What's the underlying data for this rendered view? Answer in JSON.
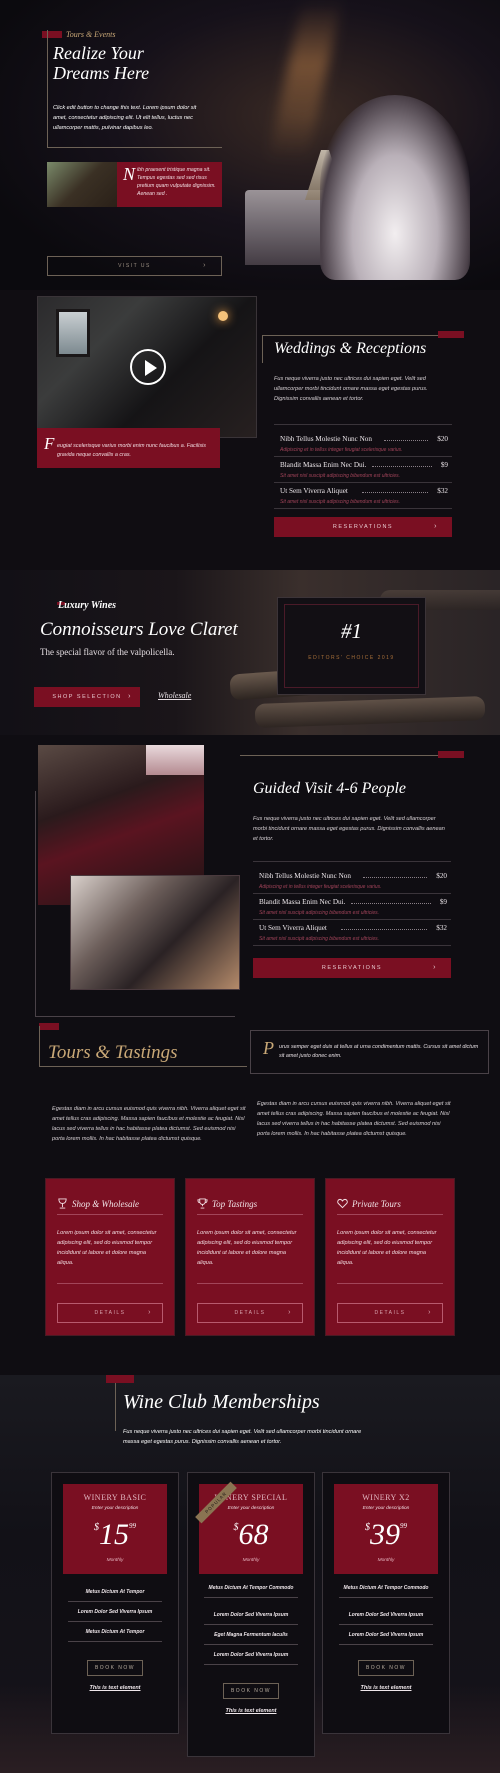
{
  "hero": {
    "tag": "Tours & Events",
    "title_line1": "Realize Your",
    "title_line2": "Dreams Here",
    "text": "Click edit button to change this text. Lorem ipsum dolor sit amet, consectetur adipiscing elit. Ut elit tellus, luctus nec ullamcorper mattis, pulvinar dapibus leo.",
    "box_dropcap": "N",
    "box_text": "ibh praesent tristique magna sit. Tempus egestas sed sed risus pretium quam vulputate dignissim. Aenean sed .",
    "visit_label": "VISIT US",
    "arrow": "›"
  },
  "weddings": {
    "title": "Weddings & Receptions",
    "text": "Fus neque viverra justo nec ultrices dui sapien eget. Velit sed ullamcorper morbi tincidunt ornare massa eget egestas purus. Dignissim convallis aenean et tortor.",
    "caption_dropcap": "F",
    "caption_text": "eugiat scelerisque varius morbi enim nunc faucibus a. Facilisis gravida neque convallis a cras.",
    "items": [
      {
        "name": "Nibh Tellus Molestie Nunc Non",
        "price": "$20",
        "desc": "Adipiscing et in tellus integer feugiat scelerisque varius."
      },
      {
        "name": "Blandit Massa Enim Nec Dui.",
        "price": "$9",
        "desc": "Sit amet nisl suscipit adipiscing bibendum est ultricies."
      },
      {
        "name": "Ut Sem Viverra Aliquet",
        "price": "$32",
        "desc": "Sit amet nisl suscipit adipiscing bibendum est ultricies."
      }
    ],
    "button": "RESERVATIONS",
    "arrow": "›"
  },
  "claret": {
    "script": "Luxury Wines",
    "title": "Connoisseurs Love Claret",
    "subtitle": "The special flavor of the valpolicella.",
    "shop_button": "SHOP SELECTION",
    "arrow": "›",
    "wholesale_link": "Wholesale",
    "badge_number": "#1",
    "badge_text": "EDITORS' CHOICE 2019"
  },
  "guided": {
    "title": "Guided Visit 4-6 People",
    "text": "Fus neque viverra justo nec ultrices dui sapien eget. Velit sed ullamcorper morbi tincidunt ornare massa eget egestas purus. Dignissim convallis aenean et tortor.",
    "items": [
      {
        "name": "Nibh Tellus Molestie Nunc Non",
        "price": "$20",
        "desc": "Adipiscing et in tellus integer feugiat scelerisque varius."
      },
      {
        "name": "Blandit Massa Enim Nec Dui.",
        "price": "$9",
        "desc": "Sit amet nisl suscipit adipiscing bibendum est ultricies."
      },
      {
        "name": "Ut Sem Viverra Aliquet",
        "price": "$32",
        "desc": "Sit amet nisl suscipit adipiscing bibendum est ultricies."
      }
    ],
    "button": "RESERVATIONS",
    "arrow": "›"
  },
  "tours": {
    "title": "Tours & Tastings",
    "side_dropcap": "P",
    "side_text": "urus semper eget duis at tellus at urna condimentum mattis. Cursus sit amet dictum sit amet justo donec enim.",
    "col1": "Egestas diam in arcu cursus euismod quis viverra nibh. Viverra aliquet eget sit amet tellus cras adipiscing. Massa sapien faucibus et molestie ac feugiat. Nisl lacus sed viverra tellus in hac habitasse platea dictumst. Sed euismod nisi porta lorem mollis. In hac habitasse platea dictumst quisque.",
    "col2": "Egestas diam in arcu cursus euismod quis viverra nibh. Viverra aliquet eget sit amet tellus cras adipiscing. Massa sapien faucibus et molestie ac feugiat. Nisl lacus sed viverra tellus in hac habitasse platea dictumst. Sed euismod nisi porta lorem mollis. In hac habitasse platea dictumst quisque.",
    "cards": [
      {
        "title": "Shop & Wholesale",
        "icon": "wine-glass-icon",
        "text": "Lorem ipsum dolor sit amet, consectetur adipiscing elit, sed do eiusmod tempor incididunt ut labore et dolore magna aliqua.",
        "button": "DETAILS"
      },
      {
        "title": "Top Tastings",
        "icon": "trophy-icon",
        "text": "Lorem ipsum dolor sit amet, consectetur adipiscing elit, sed do eiusmod tempor incididunt ut labore et dolore magna aliqua.",
        "button": "DETAILS"
      },
      {
        "title": "Private Tours",
        "icon": "heart-icon",
        "text": "Lorem ipsum dolor sit amet, consectetur adipiscing elit, sed do eiusmod tempor incididunt ut labore et dolore magna aliqua.",
        "button": "DETAILS"
      }
    ],
    "arrow": "›"
  },
  "members": {
    "title": "Wine Club Memberships",
    "text": "Fus neque viverra justo nec ultrices dui sapien eget. Velit sed ullamcorper morbi tincidunt ornare massa eget egestas purus. Dignissim convallis aenean et tortor.",
    "plans": [
      {
        "name": "WINERY BASIC",
        "desc": "Enter your description",
        "currency": "$",
        "amount": "15",
        "cents": "99",
        "period": "Monthly",
        "features": [
          "Metus Dictum At Tempor",
          "Lorem Dolor Sed Viverra Ipsum",
          "Metus Dictum At Tempor"
        ],
        "button": "BOOK NOW",
        "link": "This is text element"
      },
      {
        "name": "WINERY SPECIAL",
        "desc": "Enter your description",
        "currency": "$",
        "amount": "68",
        "cents": "",
        "period": "Monthly",
        "ribbon": "POPULAR",
        "features": [
          "Metus Dictum At Tempor Commodo",
          "Lorem Dolor Sed Viverra Ipsum",
          "Eget Magna Fermentum Iaculis",
          "Lorem Dolor Sed Viverra Ipsum"
        ],
        "button": "BOOK NOW",
        "link": "This is text element"
      },
      {
        "name": "WINERY X2",
        "desc": "Enter your description",
        "currency": "$",
        "amount": "39",
        "cents": "99",
        "period": "Monthly",
        "features": [
          "Metus Dictum At Tempor Commodo",
          "Lorem Dolor Sed Viverra Ipsum",
          "Lorem Dolor Sed Viverra Ipsum"
        ],
        "button": "BOOK NOW",
        "link": "This is text element"
      }
    ]
  },
  "colors": {
    "accent": "#7a0f22",
    "gold": "#c9a877",
    "background": "#0f0d12"
  }
}
